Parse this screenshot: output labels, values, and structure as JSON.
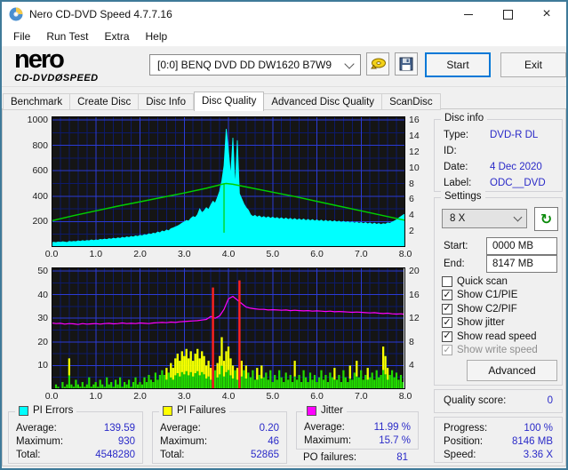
{
  "window": {
    "title": "Nero CD-DVD Speed 4.7.7.16"
  },
  "menu": {
    "items": [
      "File",
      "Run Test",
      "Extra",
      "Help"
    ]
  },
  "toolbar": {
    "logo_line1": "nero",
    "logo_line2": "CD-DVDØSPEED",
    "drive_selector": "[0:0]   BENQ DVD DD DW1620 B7W9",
    "start_button": "Start",
    "exit_button": "Exit"
  },
  "tabs": {
    "items": [
      "Benchmark",
      "Create Disc",
      "Disc Info",
      "Disc Quality",
      "Advanced Disc Quality",
      "ScanDisc"
    ],
    "active": "Disc Quality"
  },
  "disc_info": {
    "title": "Disc info",
    "rows": [
      {
        "label": "Type:",
        "value": "DVD-R DL"
      },
      {
        "label": "ID:",
        "value": ""
      },
      {
        "label": "Date:",
        "value": "4 Dec 2020"
      },
      {
        "label": "Label:",
        "value": "ODC__DVD"
      }
    ]
  },
  "settings": {
    "title": "Settings",
    "speed": "8 X",
    "start_label": "Start:",
    "start_value": "0000 MB",
    "end_label": "End:",
    "end_value": "8147 MB",
    "checkboxes": [
      {
        "label": "Quick scan",
        "checked": false,
        "disabled": false
      },
      {
        "label": "Show C1/PIE",
        "checked": true,
        "disabled": false
      },
      {
        "label": "Show C2/PIF",
        "checked": true,
        "disabled": false
      },
      {
        "label": "Show jitter",
        "checked": true,
        "disabled": false
      },
      {
        "label": "Show read speed",
        "checked": true,
        "disabled": false
      },
      {
        "label": "Show write speed",
        "checked": true,
        "disabled": true
      }
    ],
    "advanced_button": "Advanced"
  },
  "quality": {
    "label": "Quality score:",
    "value": "0"
  },
  "status": {
    "rows": [
      {
        "label": "Progress:",
        "value": "100 %"
      },
      {
        "label": "Position:",
        "value": "8146 MB"
      },
      {
        "label": "Speed:",
        "value": "3.36 X"
      }
    ]
  },
  "stats": {
    "pi_errors": {
      "title": "PI Errors",
      "color": "#00ffff",
      "rows": [
        [
          "Average:",
          "139.59"
        ],
        [
          "Maximum:",
          "930"
        ],
        [
          "Total:",
          "4548280"
        ]
      ]
    },
    "pi_failures": {
      "title": "PI Failures",
      "color": "#ffff00",
      "rows": [
        [
          "Average:",
          "0.20"
        ],
        [
          "Maximum:",
          "46"
        ],
        [
          "Total:",
          "52865"
        ]
      ]
    },
    "jitter": {
      "title": "Jitter",
      "color": "#ff00ff",
      "rows": [
        [
          "Average:",
          "11.99 %"
        ],
        [
          "Maximum:",
          "15.7 %"
        ]
      ]
    },
    "po_failures": {
      "label": "PO failures:",
      "value": "81"
    }
  },
  "chart_data": [
    {
      "name": "pi-errors-read-speed-chart",
      "type": "area",
      "title": "PI Errors and read speed vs disc position (GB)",
      "x": {
        "min": 0,
        "max": 8,
        "minor_step": 0.2,
        "labels": [
          "0.0",
          "1.0",
          "2.0",
          "3.0",
          "4.0",
          "5.0",
          "6.0",
          "7.0",
          "8.0"
        ]
      },
      "left_axis": {
        "name": "PI Errors",
        "max": 1000,
        "minor_step": 100,
        "ticks": [
          1000,
          800,
          600,
          400,
          200
        ]
      },
      "right_axis": {
        "name": "Speed (X)",
        "max": 16,
        "ticks": [
          16,
          14,
          12,
          10,
          8,
          6,
          4,
          2
        ]
      },
      "series": [
        {
          "name": "pi-errors",
          "type": "area",
          "axis": "left",
          "color": "#00ffff",
          "x_step": 0.05,
          "values": [
            34,
            38,
            35,
            40,
            37,
            42,
            39,
            36,
            44,
            41,
            45,
            42,
            48,
            44,
            50,
            46,
            52,
            49,
            55,
            51,
            56,
            53,
            60,
            57,
            63,
            59,
            66,
            62,
            70,
            65,
            72,
            68,
            76,
            71,
            80,
            75,
            84,
            79,
            88,
            83,
            92,
            88,
            98,
            94,
            104,
            99,
            110,
            105,
            118,
            112,
            126,
            120,
            134,
            128,
            144,
            150,
            158,
            166,
            176,
            188,
            198,
            210,
            205,
            225,
            240,
            232,
            255,
            300,
            270,
            285,
            310,
            295,
            330,
            360,
            345,
            390,
            440,
            520,
            640,
            930,
            760,
            560,
            860,
            470,
            840,
            420,
            380,
            340,
            310,
            290,
            255,
            240,
            250,
            235,
            245,
            230,
            240,
            228,
            238,
            226,
            236,
            224,
            232,
            220,
            230,
            218,
            228,
            216,
            226,
            214,
            224,
            212,
            222,
            210,
            220,
            208,
            218,
            206,
            216,
            205,
            214,
            203,
            212,
            201,
            210,
            200,
            208,
            198,
            206,
            196,
            204,
            194,
            202,
            192,
            200,
            190,
            198,
            188,
            196,
            186,
            194,
            184,
            192,
            182,
            190,
            180,
            188,
            178,
            186,
            176,
            184,
            180,
            190,
            186,
            196,
            205,
            215,
            228,
            240,
            252,
            260
          ]
        },
        {
          "name": "read-speed",
          "type": "line",
          "axis": "right",
          "color": "#00cf00",
          "width": 1.5,
          "points": [
            [
              0,
              3.3
            ],
            [
              0.5,
              3.95
            ],
            [
              1,
              4.55
            ],
            [
              1.5,
              5.15
            ],
            [
              2,
              5.7
            ],
            [
              2.5,
              6.25
            ],
            [
              3,
              6.8
            ],
            [
              3.5,
              7.4
            ],
            [
              3.9,
              7.95
            ],
            [
              3.95,
              8.0
            ],
            [
              4.1,
              7.9
            ],
            [
              4.5,
              7.45
            ],
            [
              5,
              6.9
            ],
            [
              5.5,
              6.35
            ],
            [
              6,
              5.75
            ],
            [
              6.5,
              5.15
            ],
            [
              7,
              4.55
            ],
            [
              7.5,
              3.95
            ],
            [
              8,
              3.36
            ]
          ]
        },
        {
          "name": "layer-break-marker",
          "type": "vline",
          "axis": "right",
          "color": "#00cf00",
          "x": 3.9,
          "v_from": 7.9,
          "v_to": 1.8
        }
      ]
    },
    {
      "name": "pi-failures-jitter-chart",
      "type": "bar",
      "title": "PI Failures and jitter vs disc position (GB)",
      "x": {
        "min": 0,
        "max": 8,
        "minor_step": 0.2,
        "labels": [
          "0.0",
          "1.0",
          "2.0",
          "3.0",
          "4.0",
          "5.0",
          "6.0",
          "7.0",
          "8.0"
        ]
      },
      "left_axis": {
        "name": "PI Failures",
        "max": 50,
        "minor_step": 5,
        "ticks": [
          50,
          40,
          30,
          20,
          10
        ]
      },
      "right_axis": {
        "name": "Jitter (%)",
        "max": 20,
        "ticks": [
          20,
          16,
          12,
          8,
          4
        ]
      },
      "right_edge_line": "#e8edf2",
      "series": [
        {
          "name": "pi-failures",
          "type": "bars",
          "axis": "left",
          "color": "#22dd00",
          "tip_color": "#ffff00",
          "tip_threshold": 9,
          "spike_color": "#ff2222",
          "spike_indices": [
            73,
            85
          ],
          "x_step": 0.05,
          "values": [
            1,
            0,
            2,
            1,
            0,
            3,
            1,
            2,
            13,
            2,
            1,
            4,
            2,
            1,
            3,
            1,
            2,
            5,
            1,
            2,
            3,
            1,
            4,
            2,
            1,
            5,
            2,
            3,
            1,
            4,
            2,
            5,
            1,
            3,
            2,
            4,
            1,
            3,
            5,
            2,
            3,
            2,
            5,
            3,
            6,
            4,
            3,
            7,
            4,
            6,
            8,
            6,
            9,
            7,
            11,
            9,
            13,
            15,
            12,
            16,
            14,
            17,
            13,
            16,
            12,
            15,
            17,
            13,
            16,
            14,
            10,
            12,
            9,
            43,
            8,
            11,
            14,
            22,
            12,
            16,
            18,
            13,
            10,
            8,
            9,
            46,
            12,
            8,
            10,
            7,
            5,
            8,
            4,
            9,
            6,
            10,
            5,
            7,
            4,
            8,
            3,
            6,
            4,
            8,
            5,
            3,
            7,
            4,
            6,
            3,
            12,
            4,
            6,
            3,
            8,
            5,
            3,
            7,
            4,
            6,
            3,
            5,
            8,
            4,
            6,
            3,
            7,
            5,
            9,
            4,
            6,
            3,
            8,
            5,
            3,
            10,
            4,
            7,
            12,
            5,
            8,
            4,
            6,
            9,
            5,
            7,
            4,
            8,
            5,
            6,
            18,
            14,
            9,
            6,
            8,
            5,
            7,
            4,
            6,
            3,
            5
          ]
        },
        {
          "name": "jitter",
          "type": "line",
          "axis": "right",
          "color": "#ff00ff",
          "width": 1.2,
          "x_step": 0.1,
          "values": [
            11.2,
            11.1,
            11.15,
            11.0,
            11.1,
            11.05,
            10.95,
            11.1,
            11.0,
            11.05,
            11.1,
            11.0,
            11.1,
            11.15,
            11.05,
            11.1,
            11.2,
            11.1,
            11.15,
            11.1,
            11.2,
            11.15,
            11.1,
            11.2,
            11.25,
            11.3,
            11.25,
            11.35,
            11.3,
            11.4,
            11.45,
            11.5,
            11.55,
            11.6,
            11.7,
            11.8,
            12.3,
            12.0,
            12.4,
            13.5,
            15.3,
            15.7,
            15.1,
            14.5,
            13.9,
            13.7,
            13.6,
            13.5,
            13.5,
            13.4,
            13.45,
            13.4,
            13.35,
            13.4,
            13.3,
            13.35,
            13.3,
            13.25,
            13.3,
            13.2,
            13.25,
            13.2,
            13.15,
            13.2,
            13.1,
            13.15,
            13.1,
            13.05,
            13.0,
            13.05,
            13.0,
            12.95,
            12.9,
            12.95,
            12.85,
            12.8,
            12.85,
            12.75,
            12.7,
            12.75,
            12.65
          ]
        }
      ]
    }
  ]
}
